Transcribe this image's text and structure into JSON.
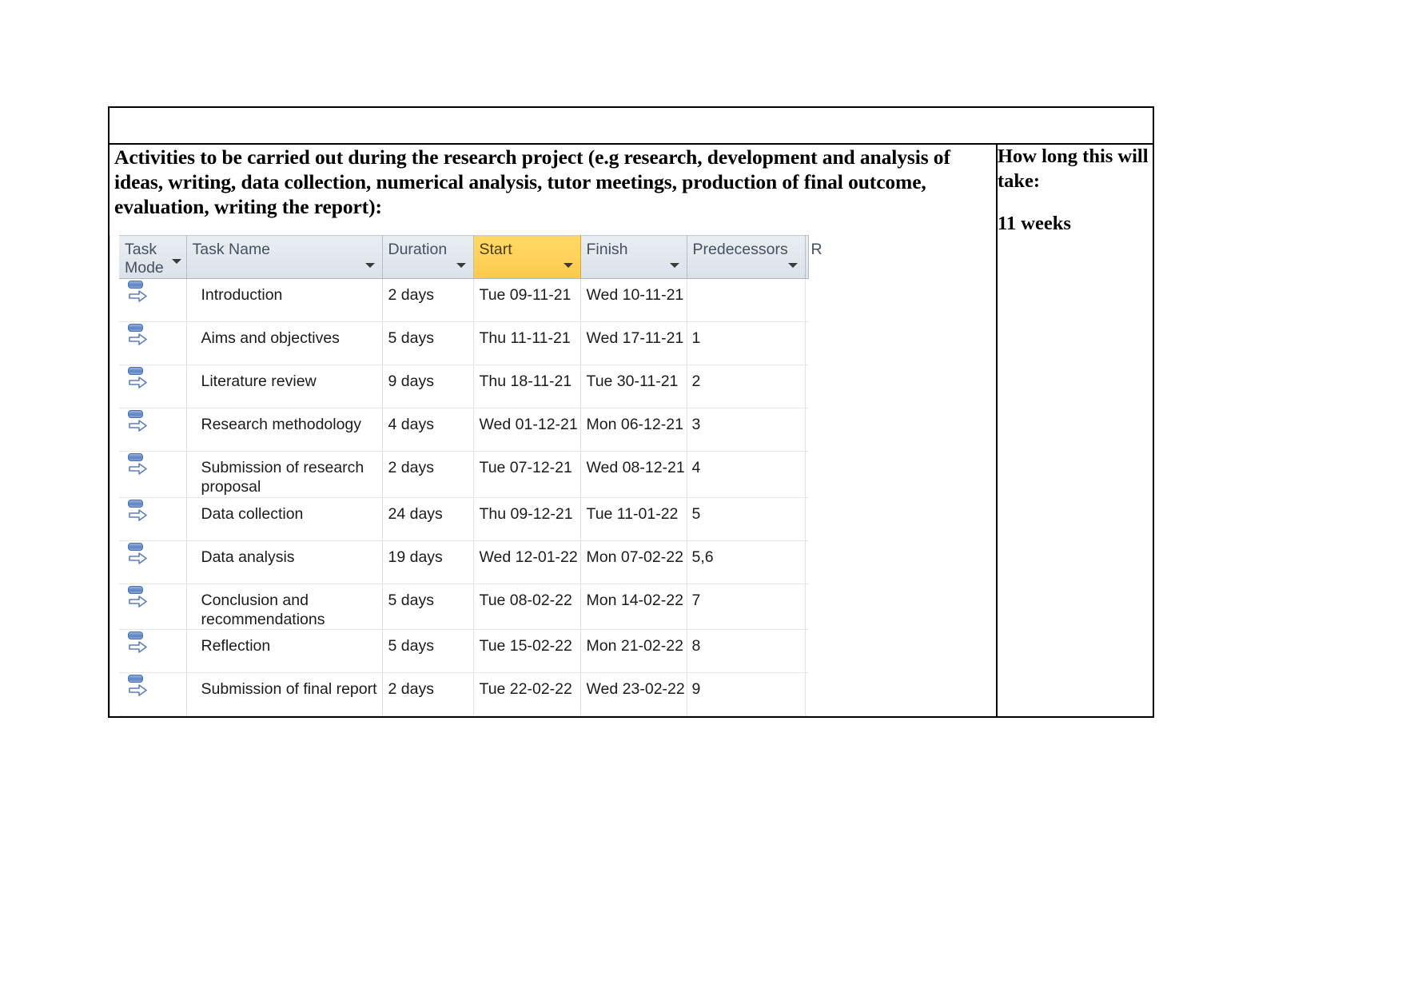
{
  "document": {
    "prompt_heading": "Activities to be carried out during the research project (e.g research, development and analysis of ideas, writing, data collection, numerical analysis, tutor meetings, production of final outcome, evaluation, writing the report):",
    "duration_heading": "How long this will take:",
    "duration_value": "11 weeks"
  },
  "colors": {
    "start_header_highlight": "#ffd25a",
    "header_background": "#e3e8ee",
    "header_text": "#44515e",
    "task_mode_icon": "#5b83c4",
    "table_border": "#000000"
  },
  "project_grid": {
    "columns": [
      {
        "key": "task_mode",
        "label": "Task Mode",
        "has_filter": true,
        "highlighted": false
      },
      {
        "key": "task_name",
        "label": "Task Name",
        "has_filter": true,
        "highlighted": false
      },
      {
        "key": "duration",
        "label": "Duration",
        "has_filter": true,
        "highlighted": false
      },
      {
        "key": "start",
        "label": "Start",
        "has_filter": true,
        "highlighted": true
      },
      {
        "key": "finish",
        "label": "Finish",
        "has_filter": true,
        "highlighted": false
      },
      {
        "key": "predecessors",
        "label": "Predecessors",
        "has_filter": true,
        "highlighted": false
      },
      {
        "key": "resource",
        "label": "R",
        "has_filter": false,
        "highlighted": false
      }
    ],
    "task_mode_icon_name": "auto-scheduled-icon",
    "rows": [
      {
        "n": 1,
        "task_name": "Introduction",
        "duration": "2 days",
        "start": "Tue 09-11-21",
        "finish": "Wed 10-11-21",
        "predecessors": ""
      },
      {
        "n": 2,
        "task_name": "Aims and objectives",
        "duration": "5 days",
        "start": "Thu 11-11-21",
        "finish": "Wed 17-11-21",
        "predecessors": "1"
      },
      {
        "n": 3,
        "task_name": "Literature review",
        "duration": "9 days",
        "start": "Thu 18-11-21",
        "finish": "Tue 30-11-21",
        "predecessors": "2"
      },
      {
        "n": 4,
        "task_name": "Research methodology",
        "duration": "4 days",
        "start": "Wed 01-12-21",
        "finish": "Mon 06-12-21",
        "predecessors": "3"
      },
      {
        "n": 5,
        "task_name": "Submission of research proposal",
        "duration": "2 days",
        "start": "Tue 07-12-21",
        "finish": "Wed 08-12-21",
        "predecessors": "4"
      },
      {
        "n": 6,
        "task_name": "Data collection",
        "duration": "24 days",
        "start": "Thu 09-12-21",
        "finish": "Tue 11-01-22",
        "predecessors": "5"
      },
      {
        "n": 7,
        "task_name": "Data analysis",
        "duration": "19 days",
        "start": "Wed 12-01-22",
        "finish": "Mon 07-02-22",
        "predecessors": "5,6"
      },
      {
        "n": 8,
        "task_name": "Conclusion and recommendations",
        "duration": "5 days",
        "start": "Tue 08-02-22",
        "finish": "Mon 14-02-22",
        "predecessors": "7"
      },
      {
        "n": 9,
        "task_name": "Reflection",
        "duration": "5 days",
        "start": "Tue 15-02-22",
        "finish": "Mon 21-02-22",
        "predecessors": "8"
      },
      {
        "n": 10,
        "task_name": "Submission of final report",
        "duration": "2 days",
        "start": "Tue 22-02-22",
        "finish": "Wed 23-02-22",
        "predecessors": "9"
      }
    ]
  }
}
